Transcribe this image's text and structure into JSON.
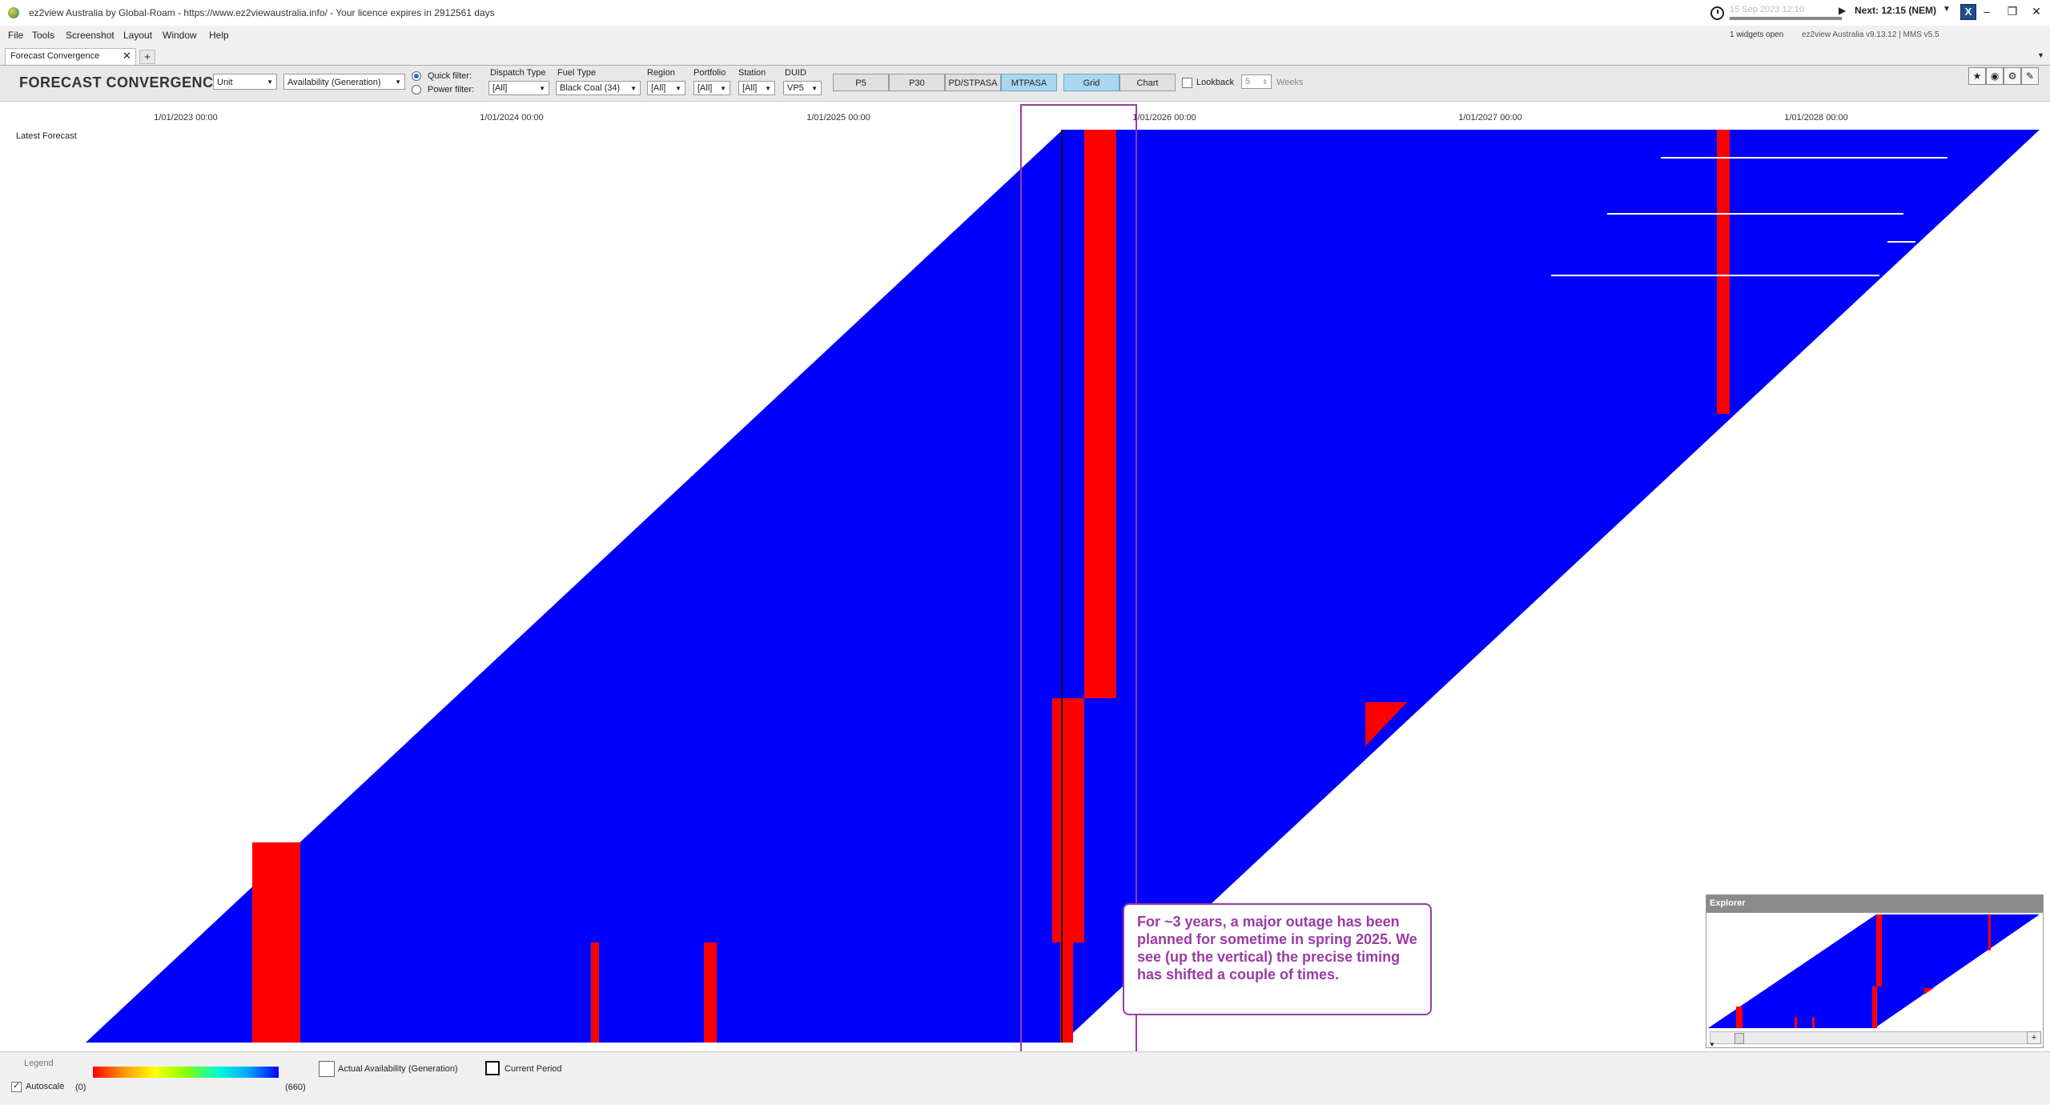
{
  "window": {
    "title": "ez2view Australia by Global-Roam - https://www.ez2viewaustralia.info/ - Your licence expires in 2912561 days",
    "time_display": "15 Sep 2023  12:10",
    "next_label": "Next: 12:15 (NEM)",
    "logo_text": "X",
    "widgets_open": "1 widgets open",
    "version": "ez2view Australia v9.13.12 | MMS v5.5",
    "controls": {
      "minimize": "–",
      "restore": "❐",
      "close": "✕"
    }
  },
  "menu": {
    "items": [
      "File",
      "Tools",
      "Screenshot",
      "Layout",
      "Window",
      "Help"
    ]
  },
  "tabs": {
    "active_label": "Forecast Convergence",
    "close": "✕",
    "add": "+"
  },
  "toolbar": {
    "title": "FORECAST CONVERGENCE",
    "unit_select": "Unit",
    "metric_select": "Availability (Generation)",
    "quick_filter": "Quick filter:",
    "power_filter": "Power filter:",
    "filters": [
      {
        "label": "Dispatch Type",
        "value": "[All]"
      },
      {
        "label": "Fuel Type",
        "value": "Black Coal (34)"
      },
      {
        "label": "Region",
        "value": "[All]"
      },
      {
        "label": "Portfolio",
        "value": "[All]"
      },
      {
        "label": "Station",
        "value": "[All]"
      },
      {
        "label": "DUID",
        "value": "VP5"
      }
    ],
    "views": [
      "P5",
      "P30",
      "PD/STPASA",
      "MTPASA"
    ],
    "active_view": "MTPASA",
    "modes": [
      "Grid",
      "Chart"
    ],
    "active_mode": "Grid",
    "lookback_label": "Lookback",
    "lookback_value": "5",
    "lookback_unit": "Weeks"
  },
  "chart": {
    "row_label": "Latest Forecast",
    "x_ticks": [
      "1/01/2023 00:00",
      "1/01/2024 00:00",
      "1/01/2025 00:00",
      "1/01/2026 00:00",
      "1/01/2027 00:00",
      "1/01/2028 00:00"
    ],
    "colors": {
      "available": "#0000ff",
      "outage": "#ff0000",
      "none": "#ffffff"
    },
    "annotation": "For ~3 years, a major outage has been planned for sometime in spring 2025.  We see (up the vertical) the precise timing has shifted a couple of times."
  },
  "explorer": {
    "title": "Explorer",
    "plus": "+"
  },
  "legend": {
    "title": "Legend",
    "min_label": "(0)",
    "max_label": "(660)",
    "autoscale_label": "Autoscale",
    "autoscale_checked": true,
    "actual_label": "Actual Availability (Generation)",
    "current_label": "Current Period"
  }
}
